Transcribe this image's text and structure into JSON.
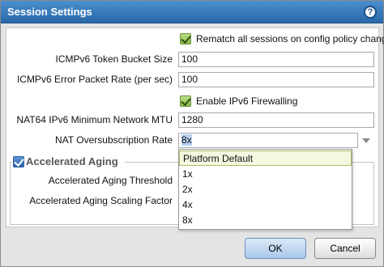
{
  "dialog": {
    "title": "Session Settings",
    "help_label": "?"
  },
  "rematch": {
    "checked": true,
    "label": "Rematch all sessions on config policy change"
  },
  "icmpv6_token_bucket": {
    "label": "ICMPv6 Token Bucket Size",
    "value": "100"
  },
  "icmpv6_error_rate": {
    "label": "ICMPv6 Error Packet Rate (per sec)",
    "value": "100"
  },
  "ipv6_firewalling": {
    "checked": true,
    "label": "Enable IPv6 Firewalling"
  },
  "nat64_mtu": {
    "label": "NAT64 IPv6 Minimum Network MTU",
    "value": "1280"
  },
  "nat_oversubscription": {
    "label": "NAT Oversubscription Rate",
    "value": "8x",
    "options": [
      "Platform Default",
      "1x",
      "2x",
      "4x",
      "8x"
    ],
    "highlighted": "Platform Default"
  },
  "accelerated_aging": {
    "checked": true,
    "label": "Accelerated Aging",
    "threshold_label": "Accelerated Aging Threshold",
    "scaling_label": "Accelerated Aging Scaling Factor"
  },
  "buttons": {
    "ok": "OK",
    "cancel": "Cancel"
  },
  "colors": {
    "titlebar": "#2f6fae",
    "checkbox_green": "#8abb4a",
    "checkbox_blue": "#2f67b0",
    "dropdown_selected_bg": "#f3f8e0"
  }
}
